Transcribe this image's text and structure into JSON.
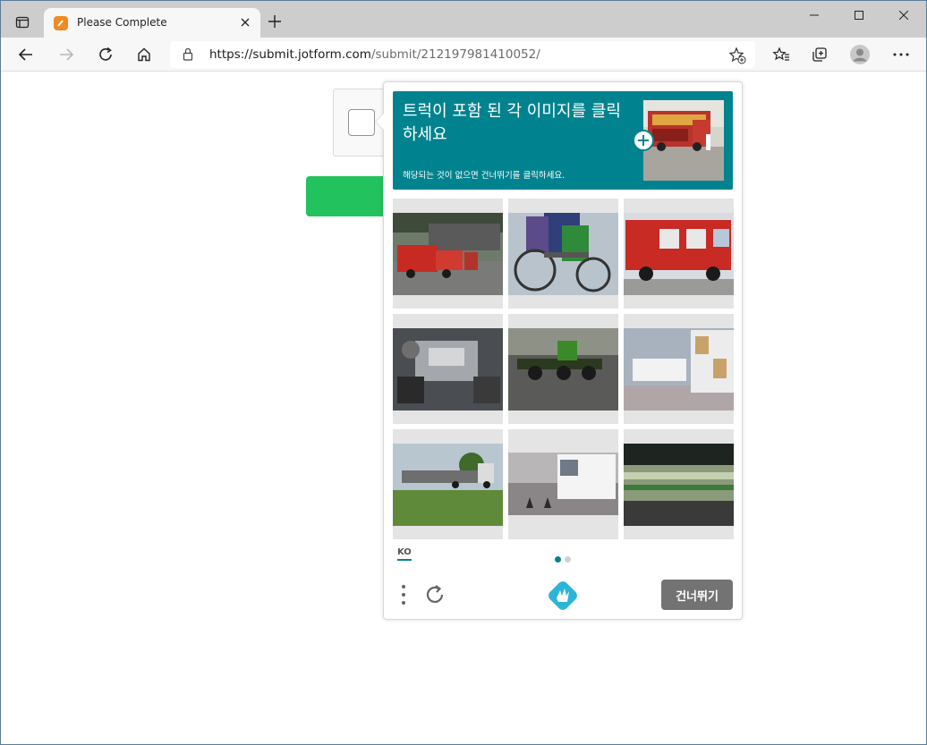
{
  "browser": {
    "tab_title": "Please Complete",
    "url_host": "https://submit.jotform.com",
    "url_path": "/submit/212197981410052/"
  },
  "captcha": {
    "prompt": "트럭이 포함 된 각 이미지를 클릭하세요",
    "sub_prompt": "해당되는 것이 없으면 건너뛰기를 클릭하세요.",
    "language": "KO",
    "skip_label": "건너뛰기",
    "accent_color": "#00838f",
    "pages_total": 2,
    "page_current": 1,
    "images": [
      "fire-truck-street",
      "bicycle-riders",
      "fire-truck-side",
      "car-engine",
      "green-tractor",
      "trailer-truck",
      "flatbed-truck-field",
      "white-truck-cones",
      "night-train"
    ]
  },
  "form": {
    "submit_color": "#22c35e"
  }
}
